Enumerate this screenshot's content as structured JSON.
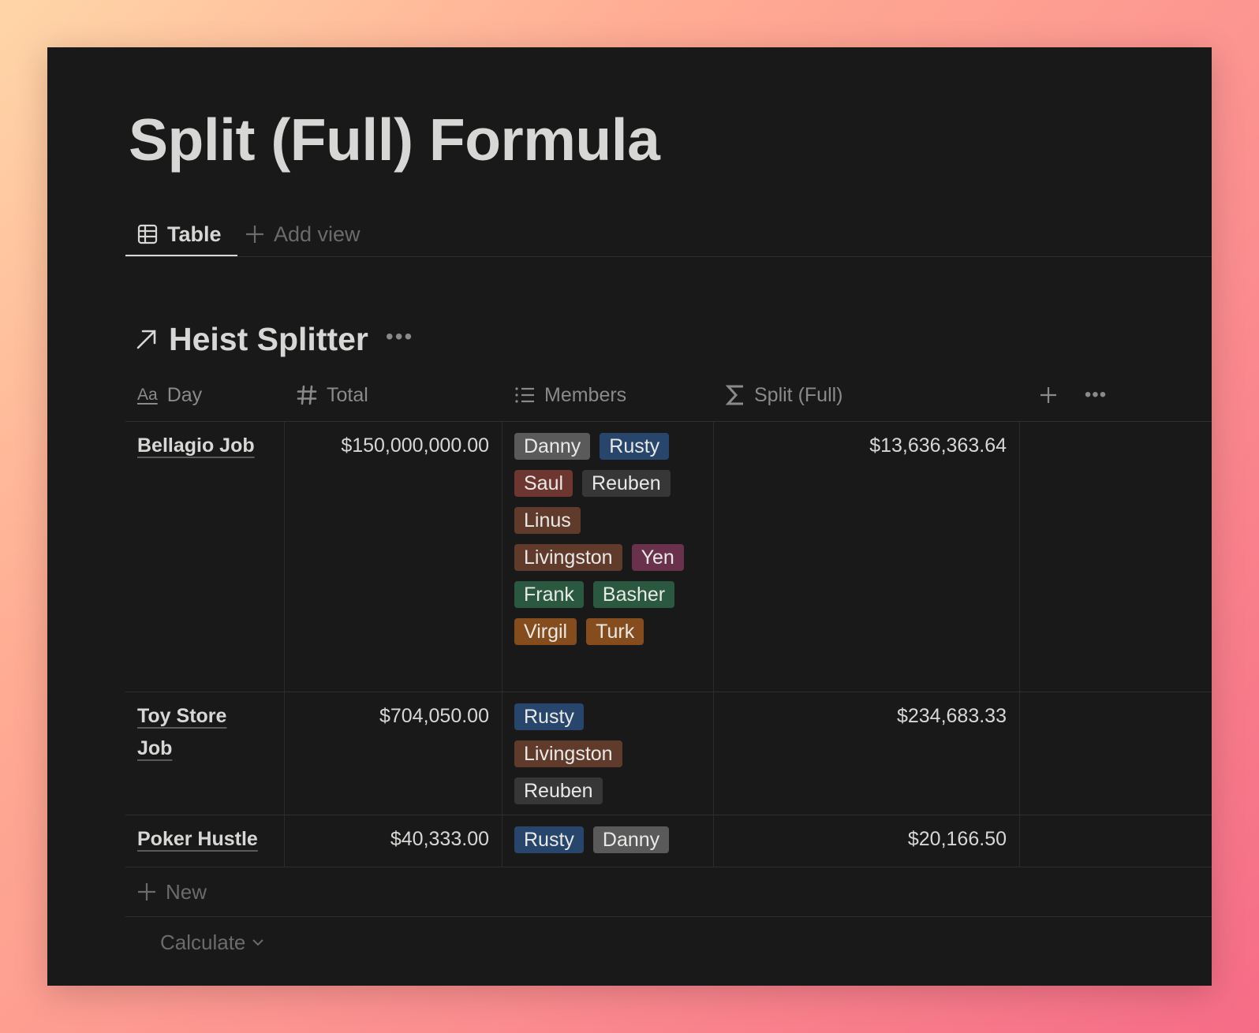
{
  "page": {
    "title": "Split (Full) Formula"
  },
  "tabs": {
    "table_label": "Table",
    "add_view_label": "Add view"
  },
  "database": {
    "title": "Heist Splitter"
  },
  "columns": {
    "day": "Day",
    "total": "Total",
    "members": "Members",
    "split": "Split (Full)"
  },
  "rows": [
    {
      "day": "Bellagio Job",
      "total": "$150,000,000.00",
      "split": "$13,636,363.64",
      "members": [
        "Danny",
        "Rusty",
        "Saul",
        "Reuben",
        "Linus",
        "Livingston",
        "Yen",
        "Frank",
        "Basher",
        "Virgil",
        "Turk"
      ]
    },
    {
      "day": "Toy Store Job",
      "total": "$704,050.00",
      "split": "$234,683.33",
      "members": [
        "Rusty",
        "Livingston",
        "Reuben"
      ]
    },
    {
      "day": "Poker Hustle",
      "total": "$40,333.00",
      "split": "$20,166.50",
      "members": [
        "Rusty",
        "Danny"
      ]
    }
  ],
  "tag_colors": {
    "Danny": "#5a5a5a",
    "Rusty": "#28456c",
    "Saul": "#6e3630",
    "Reuben": "#373737",
    "Linus": "#603b2c",
    "Livingston": "#603b2c",
    "Yen": "#69314c",
    "Frank": "#2b593f",
    "Basher": "#2b593f",
    "Virgil": "#854c1d",
    "Turk": "#854c1d"
  },
  "footer": {
    "new_label": "New",
    "calculate_label": "Calculate"
  },
  "icons": {
    "table_tab": "table-icon",
    "add_view": "plus-icon",
    "db_link": "arrow-up-right-icon",
    "db_more": "ellipsis-icon",
    "day": "text-aa-icon",
    "total": "hash-icon",
    "members": "list-icon",
    "split": "sigma-icon",
    "add_column": "plus-icon",
    "column_more": "ellipsis-icon",
    "new_row": "plus-icon",
    "calculate": "chevron-down-icon"
  }
}
